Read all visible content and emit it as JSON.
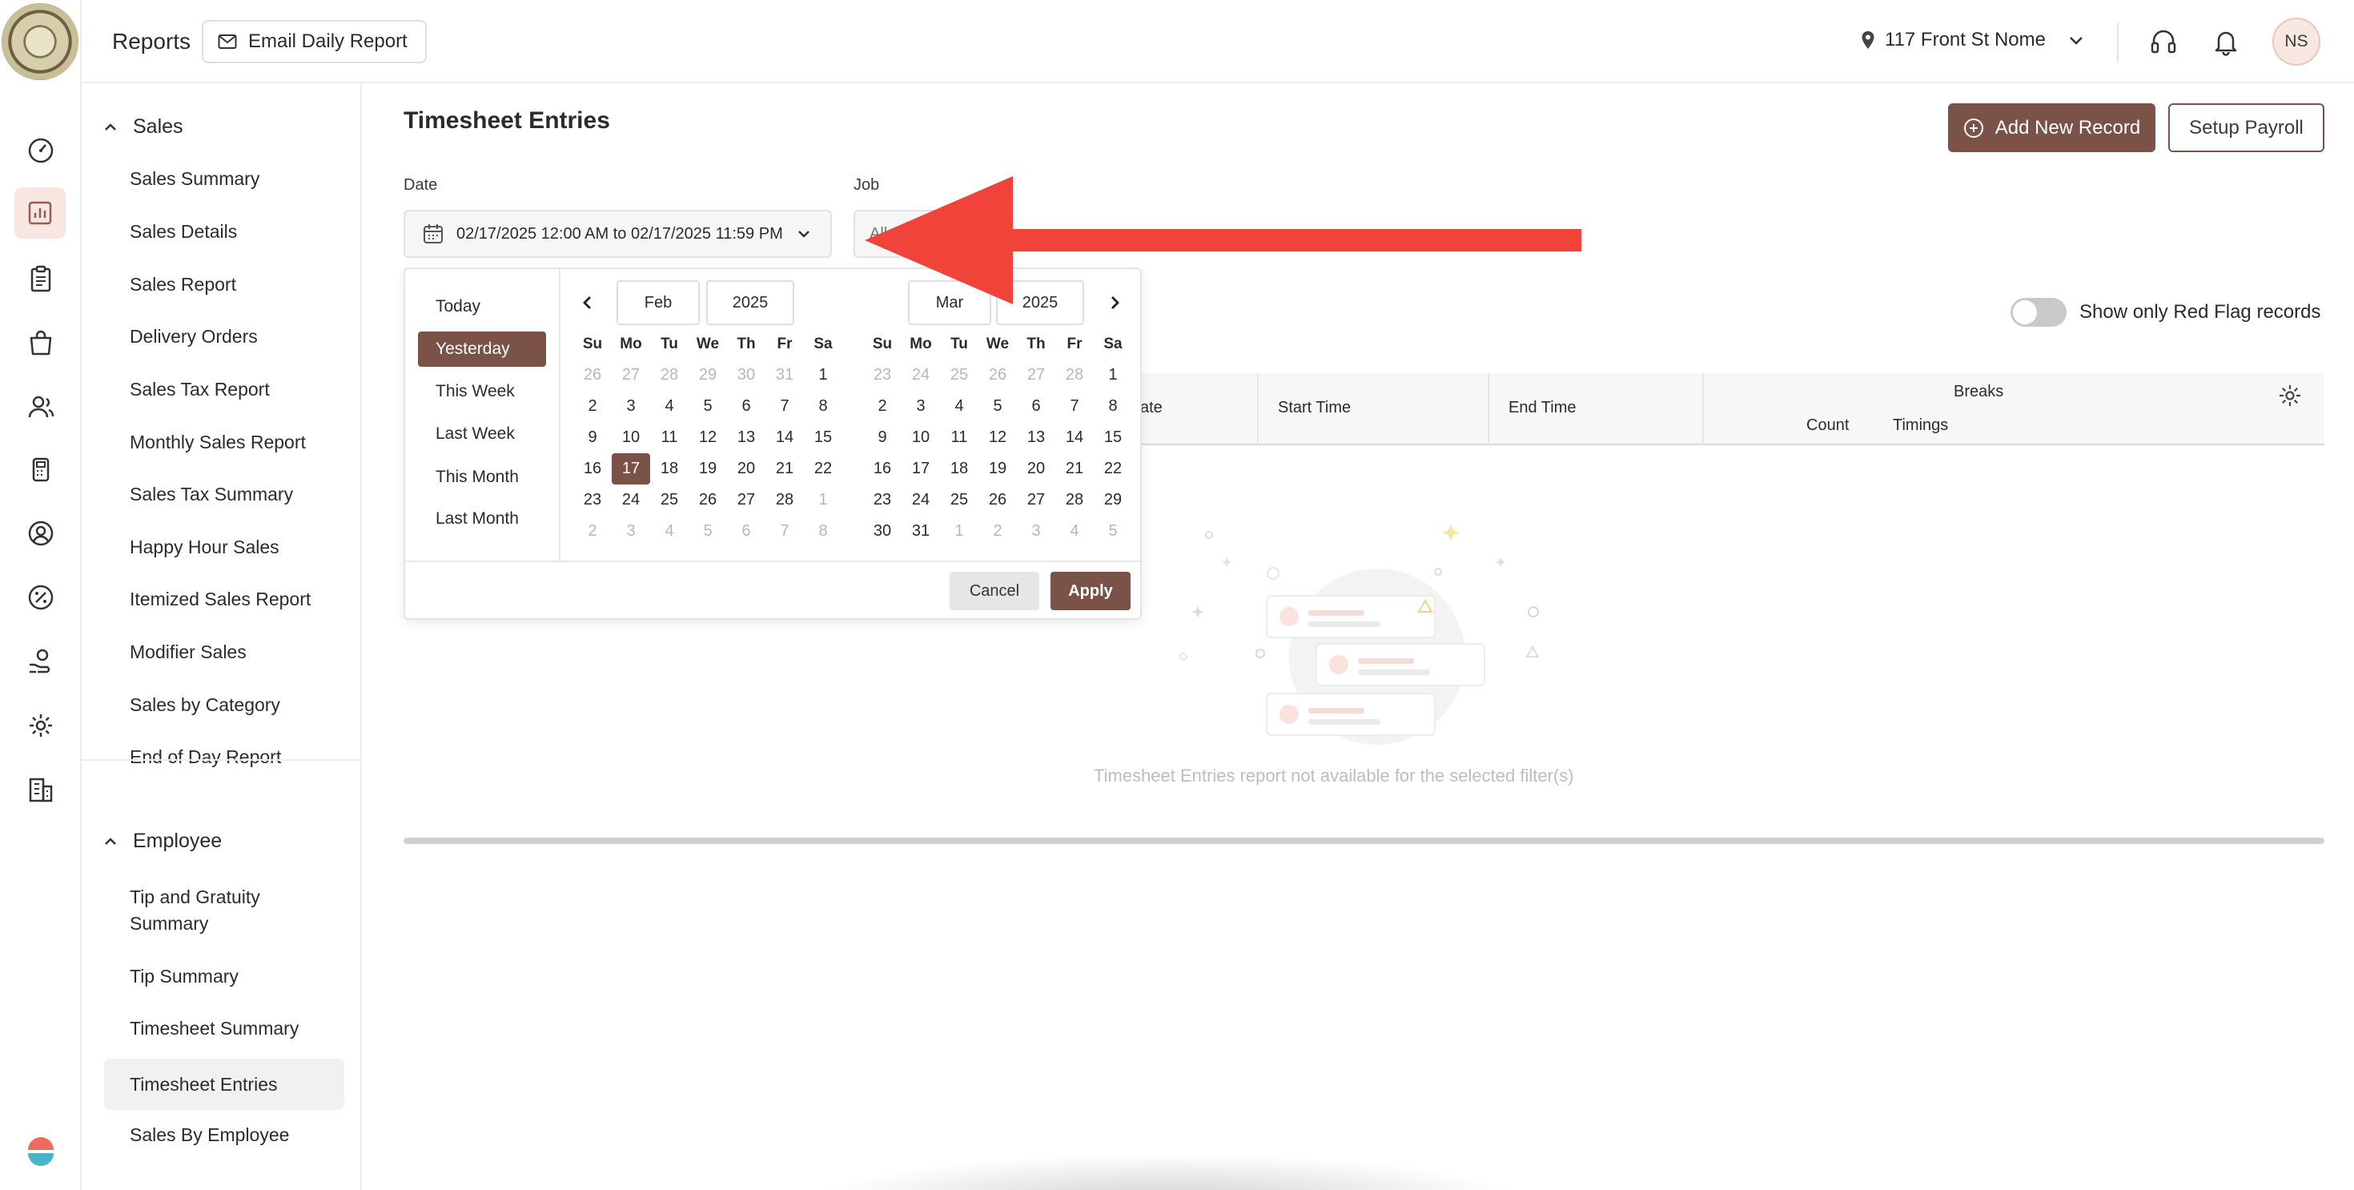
{
  "header": {
    "title": "Reports",
    "email_button": "Email Daily Report",
    "location": "117 Front St Nome",
    "avatar_initials": "NS"
  },
  "sidebar": {
    "groups": [
      {
        "label": "Sales",
        "items": [
          "Sales Summary",
          "Sales Details",
          "Sales Report",
          "Delivery Orders",
          "Sales Tax Report",
          "Monthly Sales Report",
          "Sales Tax Summary",
          "Happy Hour Sales",
          "Itemized Sales Report",
          "Modifier Sales",
          "Sales by Category",
          "End of Day Report"
        ]
      },
      {
        "label": "Employee",
        "items": [
          "Tip and Gratuity Summary",
          "Tip Summary",
          "Timesheet Summary",
          "Timesheet Entries",
          "Sales By Employee"
        ],
        "active_item": "Timesheet Entries"
      }
    ]
  },
  "main": {
    "title": "Timesheet Entries",
    "add_button": "Add New Record",
    "setup_button": "Setup Payroll",
    "date_label": "Date",
    "date_value": "02/17/2025 12:00 AM to 02/17/2025 11:59 PM",
    "job_label": "Job",
    "job_value": "All",
    "toggle_label": "Show only Red Flag records",
    "table": {
      "columns": [
        "ate",
        "Start Time",
        "End Time",
        "Breaks"
      ],
      "subcolumns": [
        "Count",
        "Timings"
      ]
    },
    "empty_message": "Timesheet Entries report not available for the selected filter(s)"
  },
  "datepicker": {
    "presets": [
      "Today",
      "Yesterday",
      "This Week",
      "Last Week",
      "This Month",
      "Last Month"
    ],
    "active_preset": "Yesterday",
    "weekdays": [
      "Su",
      "Mo",
      "Tu",
      "We",
      "Th",
      "Fr",
      "Sa"
    ],
    "left": {
      "month": "Feb",
      "year": "2025",
      "weeks": [
        [
          "26",
          "27",
          "28",
          "29",
          "30",
          "31",
          "1"
        ],
        [
          "2",
          "3",
          "4",
          "5",
          "6",
          "7",
          "8"
        ],
        [
          "9",
          "10",
          "11",
          "12",
          "13",
          "14",
          "15"
        ],
        [
          "16",
          "17",
          "18",
          "19",
          "20",
          "21",
          "22"
        ],
        [
          "23",
          "24",
          "25",
          "26",
          "27",
          "28",
          "1"
        ],
        [
          "2",
          "3",
          "4",
          "5",
          "6",
          "7",
          "8"
        ]
      ],
      "selected": "17"
    },
    "right": {
      "month": "Mar",
      "year": "2025",
      "weeks": [
        [
          "23",
          "24",
          "25",
          "26",
          "27",
          "28",
          "1"
        ],
        [
          "2",
          "3",
          "4",
          "5",
          "6",
          "7",
          "8"
        ],
        [
          "9",
          "10",
          "11",
          "12",
          "13",
          "14",
          "15"
        ],
        [
          "16",
          "17",
          "18",
          "19",
          "20",
          "21",
          "22"
        ],
        [
          "23",
          "24",
          "25",
          "26",
          "27",
          "28",
          "29"
        ],
        [
          "30",
          "31",
          "1",
          "2",
          "3",
          "4",
          "5"
        ]
      ]
    },
    "cancel": "Cancel",
    "apply": "Apply"
  },
  "colors": {
    "accent": "#7a5248",
    "accent_soft": "#f8e6e1",
    "annotation_red": "#f0433a"
  }
}
